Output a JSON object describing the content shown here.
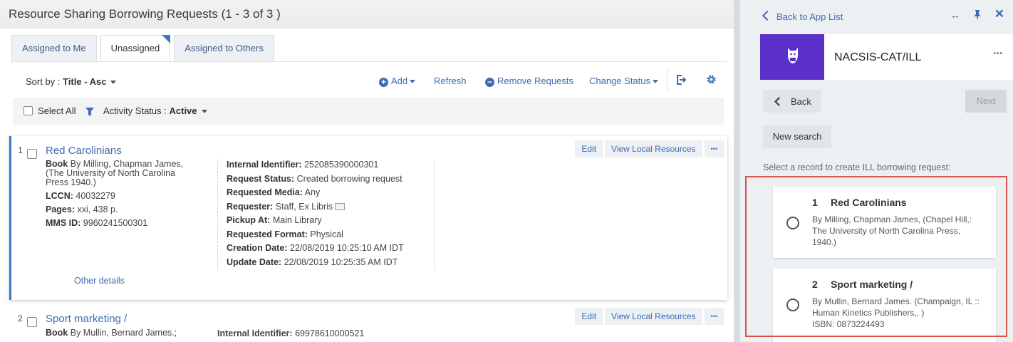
{
  "page": {
    "title": "Resource Sharing Borrowing Requests (1 - 3 of 3 )"
  },
  "tabs": [
    {
      "label": "Assigned to Me"
    },
    {
      "label": "Unassigned"
    },
    {
      "label": "Assigned to Others"
    }
  ],
  "toolbar": {
    "sort_label": "Sort by :",
    "sort_value": "Title - Asc",
    "add_label": "Add",
    "refresh_label": "Refresh",
    "remove_label": "Remove Requests",
    "change_status_label": "Change Status"
  },
  "filter": {
    "select_all_label": "Select All",
    "activity_label": "Activity Status :",
    "activity_value": "Active"
  },
  "records": [
    {
      "num": "1",
      "title": "Red Carolinians",
      "book_label": "Book",
      "book_value": "By Milling, Chapman James, (The University of North Carolina Press 1940.)",
      "lccn_label": "LCCN:",
      "lccn_value": "40032279",
      "pages_label": "Pages:",
      "pages_value": "xxi, 438 p.",
      "mms_label": "MMS ID:",
      "mms_value": "9960241500301",
      "internal_id_label": "Internal Identifier:",
      "internal_id_value": "252085390000301",
      "status_label": "Request Status:",
      "status_value": "Created borrowing request",
      "media_label": "Requested Media:",
      "media_value": "Any",
      "requester_label": "Requester:",
      "requester_value": "Staff, Ex Libris",
      "pickup_label": "Pickup At:",
      "pickup_value": "Main Library",
      "format_label": "Requested Format:",
      "format_value": "Physical",
      "creation_label": "Creation Date:",
      "creation_value": "22/08/2019 10:25:10 AM IDT",
      "update_label": "Update Date:",
      "update_value": "22/08/2019 10:25:35 AM IDT",
      "other_details": "Other details"
    },
    {
      "num": "2",
      "title": "Sport marketing /",
      "book_label": "Book",
      "book_value": "By Mullin, Bernard James.;",
      "internal_id_label": "Internal Identifier:",
      "internal_id_value": "69978610000521"
    }
  ],
  "record_buttons": {
    "edit": "Edit",
    "view_local": "View Local Resources",
    "more": "•••"
  },
  "panel": {
    "back_to_app_list": "Back to App List",
    "app_name": "NACSIS-CAT/ILL",
    "back_label": "Back",
    "next_label": "Next",
    "new_search_label": "New search",
    "instruction": "Select a record to create ILL borrowing request:",
    "results": [
      {
        "num": "1",
        "title": "Red Carolinians",
        "desc": "By Milling, Chapman James, (Chapel Hill,: The University of North Carolina Press, 1940.)"
      },
      {
        "num": "2",
        "title": "Sport marketing /",
        "desc": "By Mullin, Bernard James. (Champaign, IL :: Human Kinetics Publishers,, )",
        "isbn": "ISBN: 0873224493"
      }
    ]
  },
  "colors": {
    "accent": "#3d6cb3",
    "app_logo_bg": "#5b2fc9",
    "highlight": "#d9534f"
  },
  "icons": {
    "add": "plus-circle-icon",
    "remove": "minus-circle-icon",
    "export": "export-icon",
    "settings": "gear-icon",
    "filter": "funnel-icon",
    "expand": "expand-arrows-icon",
    "pin": "pin-icon",
    "close": "close-icon",
    "logo": "cat-logo-icon"
  }
}
